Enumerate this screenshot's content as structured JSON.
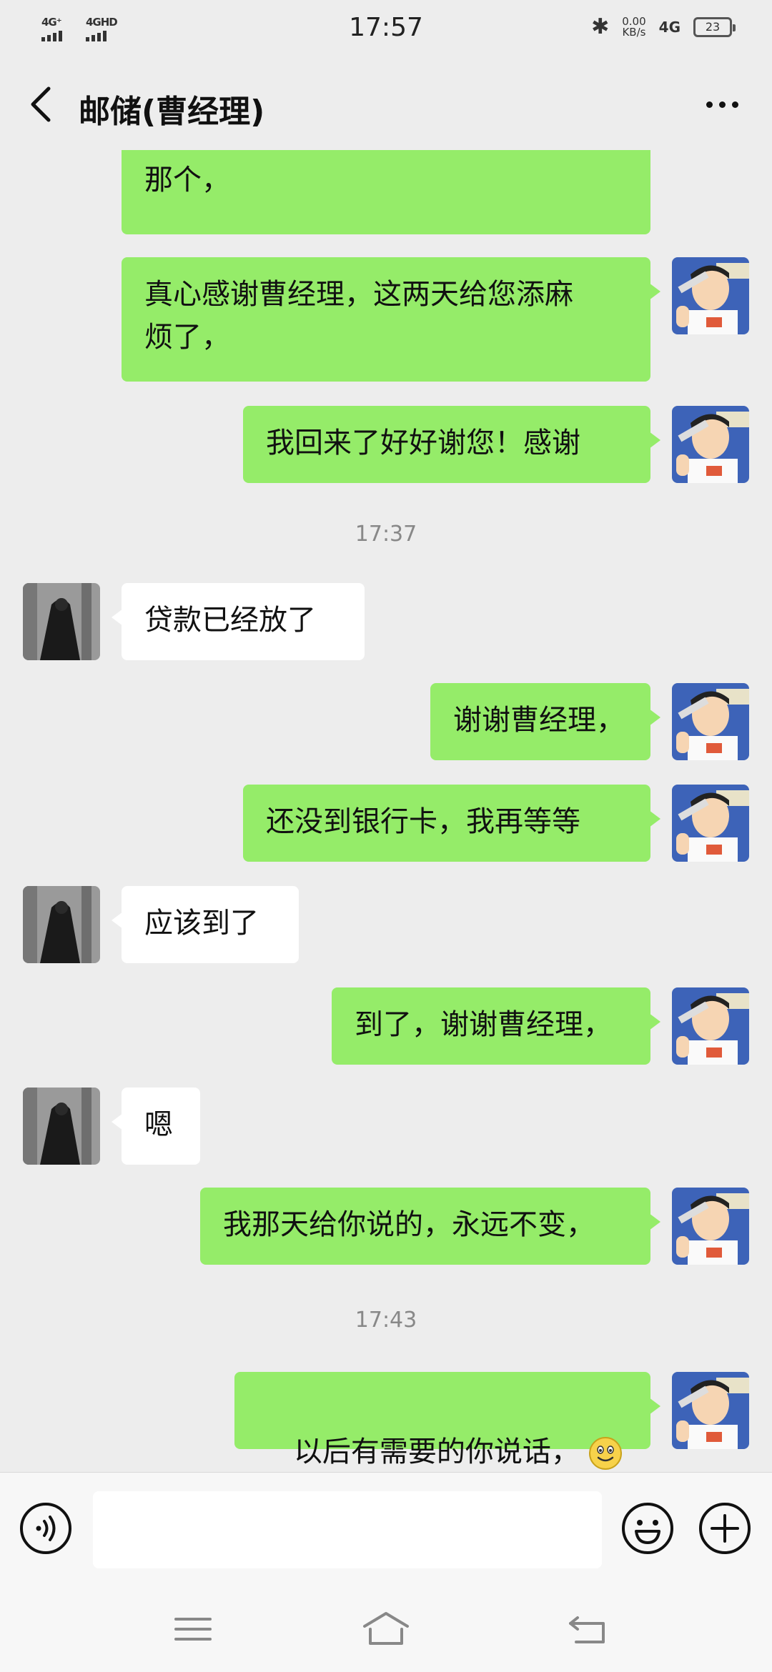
{
  "status_bar": {
    "signal_1_label": "4G⁺",
    "signal_2_label": "4GHD",
    "time": "17:57",
    "speed_value": "0.00",
    "speed_unit": "KB/s",
    "network": "4G",
    "battery": "23"
  },
  "header": {
    "title": "邮储(曹经理)"
  },
  "messages": [
    {
      "side": "me",
      "text": "回来了我你办信用卡和那个收款的\n那个，"
    },
    {
      "side": "me",
      "text": "真心感谢曹经理，这两天给您添麻\n烦了，"
    },
    {
      "side": "me",
      "text": "我回来了好好谢您！感谢"
    },
    {
      "time": "17:37"
    },
    {
      "side": "other",
      "text": "贷款已经放了"
    },
    {
      "side": "me",
      "text": "谢谢曹经理，"
    },
    {
      "side": "me",
      "text": "还没到银行卡，我再等等"
    },
    {
      "side": "other",
      "text": "应该到了"
    },
    {
      "side": "me",
      "text": "到了，谢谢曹经理，"
    },
    {
      "side": "other",
      "text": "嗯"
    },
    {
      "side": "me",
      "text": "我那天给你说的，永远不变，"
    },
    {
      "time": "17:43"
    },
    {
      "side": "me",
      "text": "以后有需要的你说话，",
      "emoji": "smile-emoji"
    }
  ],
  "input": {
    "value": "",
    "placeholder": ""
  },
  "icons": {
    "voice": "voice-icon",
    "emoji": "emoji-icon",
    "plus": "plus-icon",
    "menu": "menu-icon",
    "home": "home-icon",
    "back": "back-icon"
  },
  "colors": {
    "background": "#ededed",
    "my_bubble": "#95ec69",
    "other_bubble": "#ffffff",
    "timestamp": "#888888"
  }
}
